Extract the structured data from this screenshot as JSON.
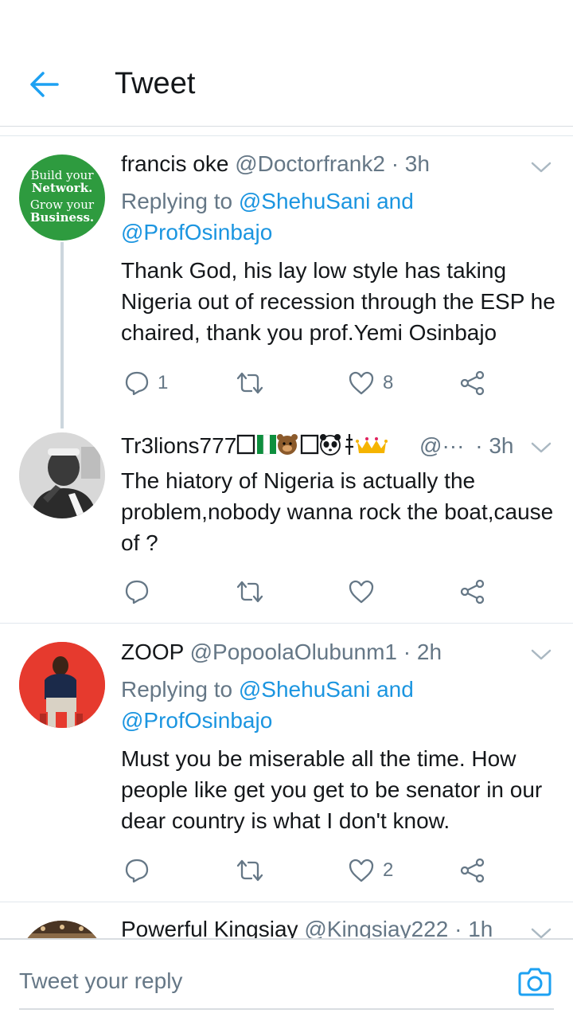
{
  "header": {
    "title": "Tweet"
  },
  "tweets": [
    {
      "name": "francis oke",
      "handle": "@Doctorfrank2",
      "dot": "·",
      "time": "3h",
      "replying_prefix": "Replying to",
      "mention1": "@ShehuSani",
      "and": "and",
      "mention2": "@ProfOsinbajo",
      "text": "Thank God, his lay low style has taking Nigeria out of recession through the ESP he chaired, thank you prof.Yemi Osinbajo",
      "reply_count": "1",
      "like_count": "8",
      "avatar": {
        "line1": "Build your",
        "line2": "Network.",
        "line3": "Grow your",
        "line4": "Business."
      }
    },
    {
      "name": "Tr3lions777",
      "handle": "@···",
      "dot": "·",
      "time": "3h",
      "text": "The hiatory of Nigeria is actually the problem,nobody wanna rock the boat,cause of ?"
    },
    {
      "name": "ZOOP",
      "handle": "@PopoolaOlubunm1",
      "dot": "·",
      "time": "2h",
      "replying_prefix": "Replying to",
      "mention1": "@ShehuSani",
      "and": "and",
      "mention2": "@ProfOsinbajo",
      "text": "Must you be miserable all the time. How people like get you get to be senator in our dear country is what I don't know.",
      "like_count": "2"
    },
    {
      "name": "Powerful Kingsiay",
      "handle": "@Kingsiay222",
      "dot": "·",
      "time": "1h"
    }
  ],
  "reply_bar": {
    "placeholder": "Tweet your reply"
  },
  "colors": {
    "accent": "#1da1f2",
    "link": "#1b95e0",
    "muted": "#657786",
    "text": "#14171a",
    "divider": "#e1e8ed"
  },
  "icons": [
    "back-arrow-icon",
    "chevron-down-icon",
    "reply-icon",
    "retweet-icon",
    "like-icon",
    "share-icon",
    "camera-icon"
  ]
}
